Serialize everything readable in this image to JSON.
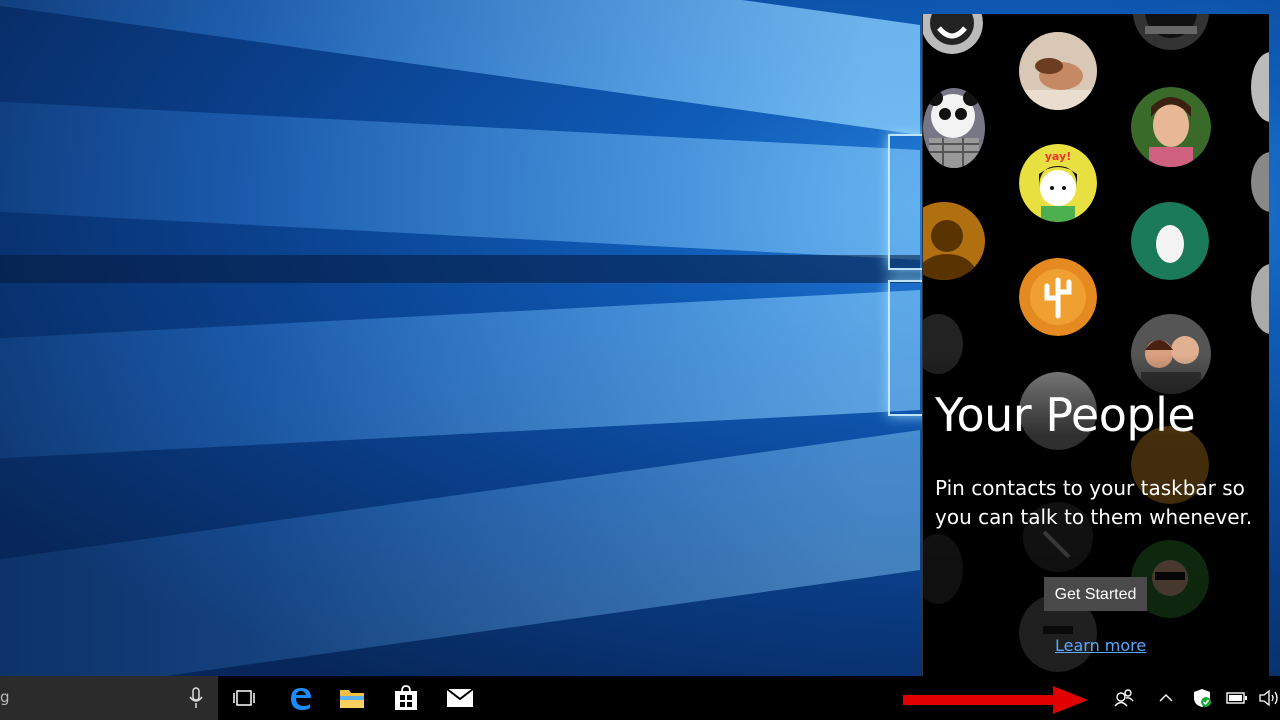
{
  "panel": {
    "title": "Your People",
    "description": "Pin contacts to your taskbar so you can talk to them whenever.",
    "get_started_label": "Get Started",
    "learn_more_label": "Learn more",
    "avatars": [
      "smiley",
      "hands",
      "camera",
      "panda",
      "woman",
      "yay-girl",
      "silhouette",
      "egg",
      "cactus",
      "couple",
      "contact-1",
      "contact-2",
      "contact-3",
      "contact-4",
      "contact-5",
      "contact-6",
      "contact-7",
      "contact-8",
      "contact-9",
      "contact-10"
    ],
    "yay_text": "yay!"
  },
  "taskbar": {
    "search_text": "g",
    "pinned": [
      "task-view-icon",
      "edge-icon",
      "file-explorer-icon",
      "store-icon",
      "mail-icon"
    ],
    "tray": [
      "people-icon",
      "chevron-up-icon",
      "defender-shield-icon",
      "battery-icon",
      "volume-icon"
    ]
  },
  "colors": {
    "accent_red": "#e00000",
    "link_blue": "#5aa9ff",
    "button_gray": "#4a4a4a",
    "edge_blue": "#1a8cff",
    "explorer_yellow": "#f0c040"
  }
}
